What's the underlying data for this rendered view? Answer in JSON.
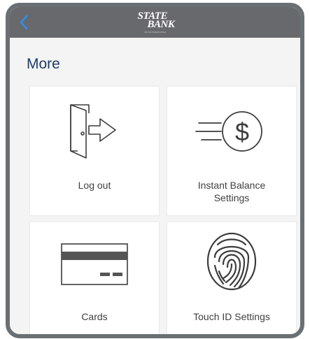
{
  "header": {
    "logo_line1": "STATE",
    "logo_line2": "BANK",
    "logo_tagline": "OF SOUTHERN UTAH"
  },
  "page": {
    "title": "More"
  },
  "tiles": [
    {
      "label": "Log out",
      "icon": "log-out-door-icon"
    },
    {
      "label": "Instant Balance Settings",
      "icon": "instant-balance-dollar-icon"
    },
    {
      "label": "Cards",
      "icon": "credit-card-icon"
    },
    {
      "label": "Touch ID Settings",
      "icon": "fingerprint-icon"
    }
  ],
  "colors": {
    "header_bg": "#68696c",
    "frame_border": "#6a6f73",
    "title": "#1f3d68",
    "icon_stroke": "#3d3d3d"
  }
}
